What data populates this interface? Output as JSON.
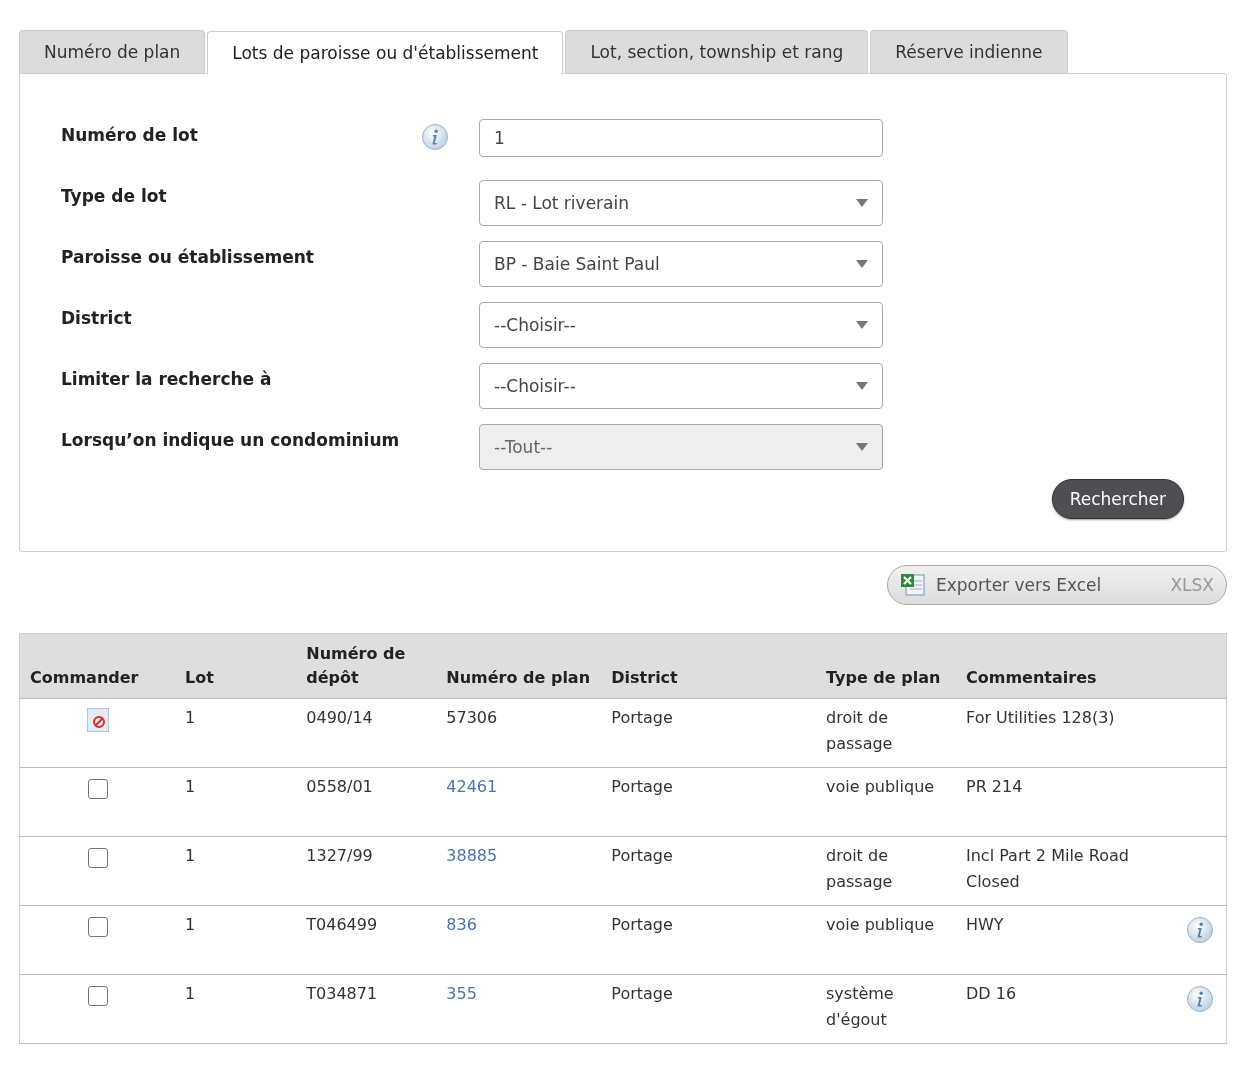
{
  "tabs": [
    {
      "label": "Numéro de plan",
      "selected": false
    },
    {
      "label": "Lots de paroisse ou d'établissement",
      "selected": true
    },
    {
      "label": "Lot, section, township et rang",
      "selected": false
    },
    {
      "label": "Réserve indienne",
      "selected": false
    }
  ],
  "form": {
    "fields": [
      {
        "label": "Numéro de lot",
        "kind": "text",
        "value": "1",
        "info": true,
        "disabled": false
      },
      {
        "label": "Type de lot",
        "kind": "select",
        "value": "RL - Lot riverain",
        "info": false,
        "disabled": false
      },
      {
        "label": "Paroisse ou établissement",
        "kind": "select",
        "value": "BP - Baie Saint Paul",
        "info": false,
        "disabled": false
      },
      {
        "label": "District",
        "kind": "select",
        "value": "--Choisir--",
        "info": false,
        "disabled": false
      },
      {
        "label": "Limiter la recherche à",
        "kind": "select",
        "value": "--Choisir--",
        "info": false,
        "disabled": false
      },
      {
        "label": "Lorsqu’on indique un condominium",
        "kind": "select",
        "value": "--Tout--",
        "info": false,
        "disabled": true
      }
    ],
    "search_button": "Rechercher"
  },
  "export": {
    "label": "Exporter vers Excel",
    "format": "XLSX"
  },
  "table": {
    "columns": [
      "Commander",
      "Lot",
      "Numéro de dépôt",
      "Numéro de plan",
      "District",
      "Type de plan",
      "Commentaires"
    ],
    "rows": [
      {
        "order": {
          "kind": "unavailable"
        },
        "lot": "1",
        "depot": "0490/14",
        "plan": "57306",
        "plan_link": false,
        "district": "Portage",
        "type": "droit de passage",
        "comment": "For Utilities 128(3)",
        "info": false
      },
      {
        "order": {
          "kind": "checkbox",
          "checked": false
        },
        "lot": "1",
        "depot": "0558/01",
        "plan": "42461",
        "plan_link": true,
        "district": "Portage",
        "type": "voie publique",
        "comment": "PR 214",
        "info": false
      },
      {
        "order": {
          "kind": "checkbox",
          "checked": false
        },
        "lot": "1",
        "depot": "1327/99",
        "plan": "38885",
        "plan_link": true,
        "district": "Portage",
        "type": "droit de passage",
        "comment": "Incl Part 2 Mile Road Closed",
        "info": false
      },
      {
        "order": {
          "kind": "checkbox",
          "checked": false
        },
        "lot": "1",
        "depot": "T046499",
        "plan": "836",
        "plan_link": true,
        "district": "Portage",
        "type": "voie publique",
        "comment": "HWY",
        "info": true
      },
      {
        "order": {
          "kind": "checkbox",
          "checked": false
        },
        "lot": "1",
        "depot": "T034871",
        "plan": "355",
        "plan_link": true,
        "district": "Portage",
        "type": "système d'égout",
        "comment": "DD 16",
        "info": true
      }
    ]
  }
}
